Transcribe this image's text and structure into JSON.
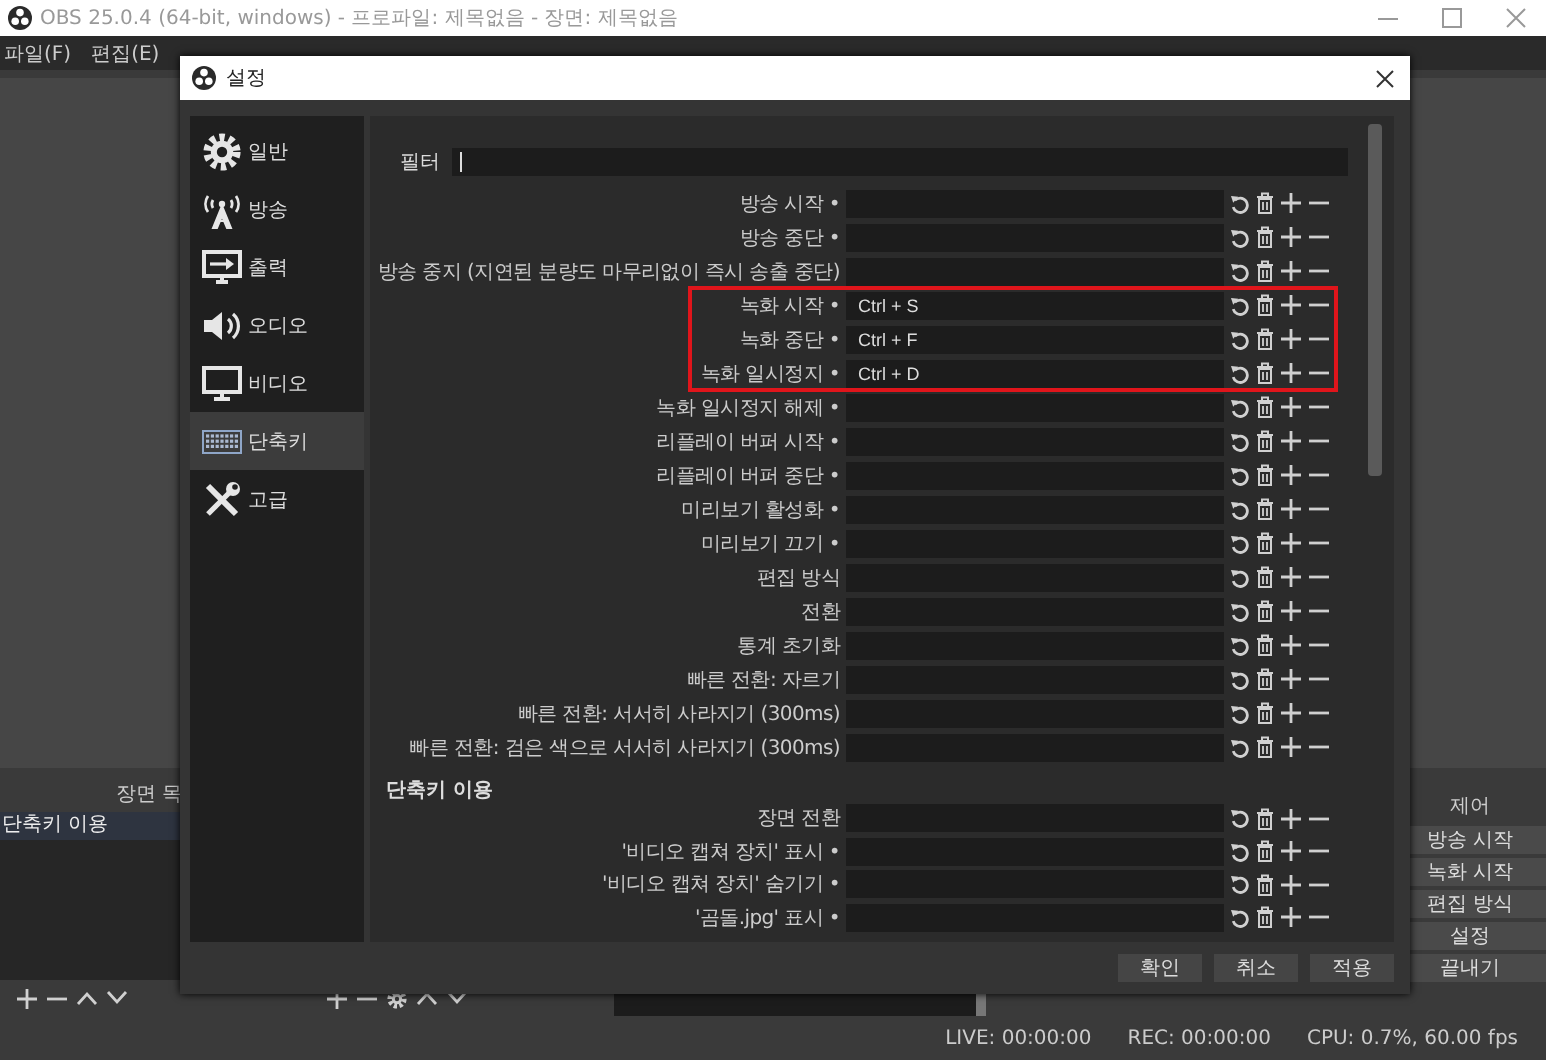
{
  "window": {
    "title": "OBS 25.0.4 (64-bit, windows) - 프로파일: 제목없음 - 장면: 제목없음"
  },
  "menu": [
    "파일(F)",
    "편집(E)"
  ],
  "scene_dock": {
    "title": "장면 목",
    "items": [
      "단축키 이용"
    ]
  },
  "controls_dock": {
    "title": "제어",
    "buttons": [
      "방송 시작",
      "녹화 시작",
      "편집 방식",
      "설정",
      "끝내기"
    ]
  },
  "status_bar": {
    "live": "LIVE: 00:00:00",
    "rec": "REC: 00:00:00",
    "cpu": "CPU: 0.7%, 60.00 fps"
  },
  "dialog": {
    "title": "설정",
    "sidebar": [
      {
        "label": "일반",
        "kind": "gear",
        "selected": false
      },
      {
        "label": "방송",
        "kind": "antenna",
        "selected": false
      },
      {
        "label": "출력",
        "kind": "output",
        "selected": false
      },
      {
        "label": "오디오",
        "kind": "audio",
        "selected": false
      },
      {
        "label": "비디오",
        "kind": "video",
        "selected": false
      },
      {
        "label": "단축키",
        "kind": "keyboard",
        "selected": true
      },
      {
        "label": "고급",
        "kind": "tools",
        "selected": false
      }
    ],
    "filter_label": "필터",
    "hotkeys": [
      {
        "label": "방송 시작 •",
        "highlighted": false
      },
      {
        "label": "방송 중단 •",
        "highlighted": false
      },
      {
        "label": "방송 중지 (지연된 분량도 마무리없이 즉시 송출 중단)",
        "highlighted": false
      },
      {
        "label": "녹화 시작 •",
        "value": "Ctrl + S",
        "highlighted": true
      },
      {
        "label": "녹화 중단 •",
        "value": "Ctrl + F",
        "highlighted": true
      },
      {
        "label": "녹화 일시정지 •",
        "value": "Ctrl + D",
        "highlighted": true
      },
      {
        "label": "녹화 일시정지 해제 •",
        "highlighted": false
      },
      {
        "label": "리플레이 버퍼 시작 •",
        "highlighted": false
      },
      {
        "label": "리플레이 버퍼 중단 •",
        "highlighted": false
      },
      {
        "label": "미리보기 활성화 •",
        "highlighted": false
      },
      {
        "label": "미리보기 끄기 •",
        "highlighted": false
      },
      {
        "label": "편집 방식",
        "highlighted": false
      },
      {
        "label": "전환",
        "highlighted": false
      },
      {
        "label": "통계 초기화",
        "highlighted": false
      },
      {
        "label": "빠른 전환: 자르기",
        "highlighted": false
      },
      {
        "label": "빠른 전환: 서서히 사라지기 (300ms)",
        "highlighted": false
      },
      {
        "label": "빠른 전환: 검은 색으로 서서히 사라지기 (300ms)",
        "highlighted": false
      }
    ],
    "groups": [
      {
        "title": "단축키 이용",
        "hotkeys": [
          {
            "label": "장면 전환",
            "highlighted": false
          },
          {
            "label": "'비디오 캡쳐 장치' 표시 •",
            "highlighted": false
          },
          {
            "label": "'비디오 캡쳐 장치' 숨기기 •",
            "highlighted": false
          },
          {
            "label": "'곰돌.jpg' 표시 •",
            "highlighted": false
          }
        ]
      }
    ],
    "buttons": [
      "확인",
      "취소",
      "적용"
    ]
  }
}
